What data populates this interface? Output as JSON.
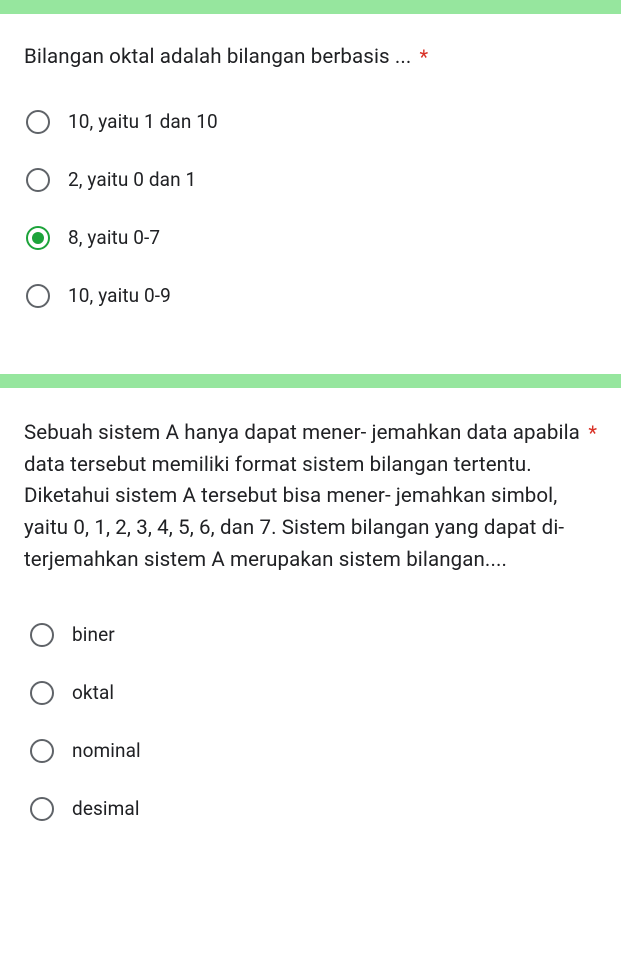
{
  "question1": {
    "text": "Bilangan oktal adalah bilangan berbasis ...",
    "required_marker": "*",
    "options": [
      {
        "label": "10, yaitu 1 dan 10",
        "selected": false
      },
      {
        "label": "2, yaitu 0 dan 1",
        "selected": false
      },
      {
        "label": "8, yaitu 0-7",
        "selected": true
      },
      {
        "label": "10, yaitu 0-9",
        "selected": false
      }
    ]
  },
  "question2": {
    "text": "Sebuah sistem A hanya dapat mener- jemahkan data apabila data tersebut memiliki format sistem bilangan tertentu. Diketahui sistem A tersebut bisa mener- jemahkan simbol, yaitu 0, 1, 2, 3, 4, 5, 6, dan 7. Sistem bilangan yang dapat di- terjemahkan sistem A merupakan sistem bilangan....",
    "required_marker": "*",
    "options": [
      {
        "label": "biner",
        "selected": false
      },
      {
        "label": "oktal",
        "selected": false
      },
      {
        "label": "nominal",
        "selected": false
      },
      {
        "label": "desimal",
        "selected": false
      }
    ]
  }
}
